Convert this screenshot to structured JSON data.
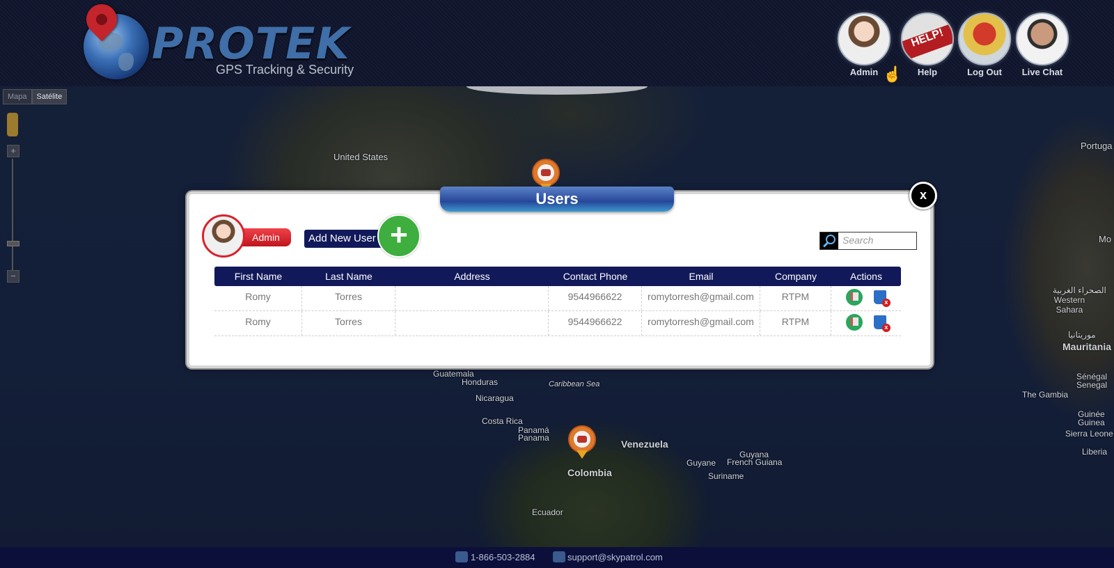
{
  "header": {
    "brand": "PROTEK",
    "tagline": "GPS Tracking & Security",
    "nav": [
      {
        "label": "Admin"
      },
      {
        "label": "Help"
      },
      {
        "label": "Log Out"
      },
      {
        "label": "Live Chat"
      }
    ],
    "help_icon_text": "HELP!"
  },
  "map": {
    "types": [
      "Mapa",
      "Satélite"
    ],
    "selected_type": "Satélite",
    "labels": [
      "United States",
      "Portuga",
      "Guatemala",
      "Honduras",
      "Nicaragua",
      "Caribbean Sea",
      "Costa Rica",
      "Panamá",
      "Panama",
      "Venezuela",
      "Guyana",
      "Guyane",
      "French Guiana",
      "Suriname",
      "Colombia",
      "Ecuador",
      "Western Sahara",
      "Mauritania",
      "Sénégal",
      "Senegal",
      "The Gambia",
      "Guinée",
      "Guinea",
      "Sierra Leone",
      "Liberia",
      "Mo"
    ],
    "arabic_labels": [
      "الصحراء الغربية",
      "موريتانيا"
    ]
  },
  "modal": {
    "title": "Users",
    "close_label": "x",
    "current_user_role": "Admin",
    "add_button_label": "Add New User",
    "search_placeholder": "Search",
    "columns": [
      "First Name",
      "Last Name",
      "Address",
      "Contact Phone",
      "Email",
      "Company",
      "Actions"
    ],
    "rows": [
      {
        "first_name": "Romy",
        "last_name": "Torres",
        "address": "",
        "phone": "9544966622",
        "email": "romytorresh@gmail.com",
        "company": "RTPM"
      },
      {
        "first_name": "Romy",
        "last_name": "Torres",
        "address": "",
        "phone": "9544966622",
        "email": "romytorresh@gmail.com",
        "company": "RTPM"
      }
    ]
  },
  "footer": {
    "phone": "1-866-503-2884",
    "email": "support@skypatrol.com"
  },
  "colors": {
    "header_bg": "#10152a",
    "table_header_bg": "#12195a",
    "admin_red": "#d9212c",
    "add_green": "#3eae3f",
    "title_blue": "#27479a"
  }
}
